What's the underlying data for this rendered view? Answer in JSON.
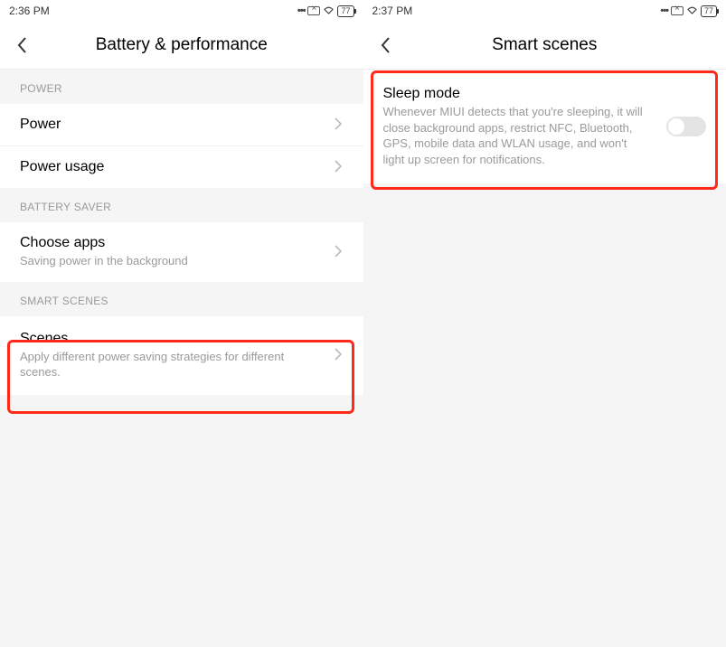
{
  "colors": {
    "highlight": "#ff2a1a"
  },
  "left": {
    "status": {
      "time": "2:36 PM",
      "battery": "77"
    },
    "title": "Battery & performance",
    "sections": {
      "power": {
        "header": "POWER",
        "items": [
          {
            "title": "Power"
          },
          {
            "title": "Power usage"
          }
        ]
      },
      "saver": {
        "header": "BATTERY SAVER",
        "items": [
          {
            "title": "Choose apps",
            "sub": "Saving power in the background"
          }
        ]
      },
      "scenes": {
        "header": "SMART SCENES",
        "items": [
          {
            "title": "Scenes",
            "sub": "Apply different power saving strategies for different scenes."
          }
        ]
      }
    }
  },
  "right": {
    "status": {
      "time": "2:37 PM",
      "battery": "77"
    },
    "title": "Smart scenes",
    "item": {
      "title": "Sleep mode",
      "sub": "Whenever MIUI detects that you're sleeping, it will close background apps, restrict NFC, Bluetooth, GPS, mobile data and WLAN usage, and won't light up screen for notifications.",
      "toggle": false
    }
  }
}
